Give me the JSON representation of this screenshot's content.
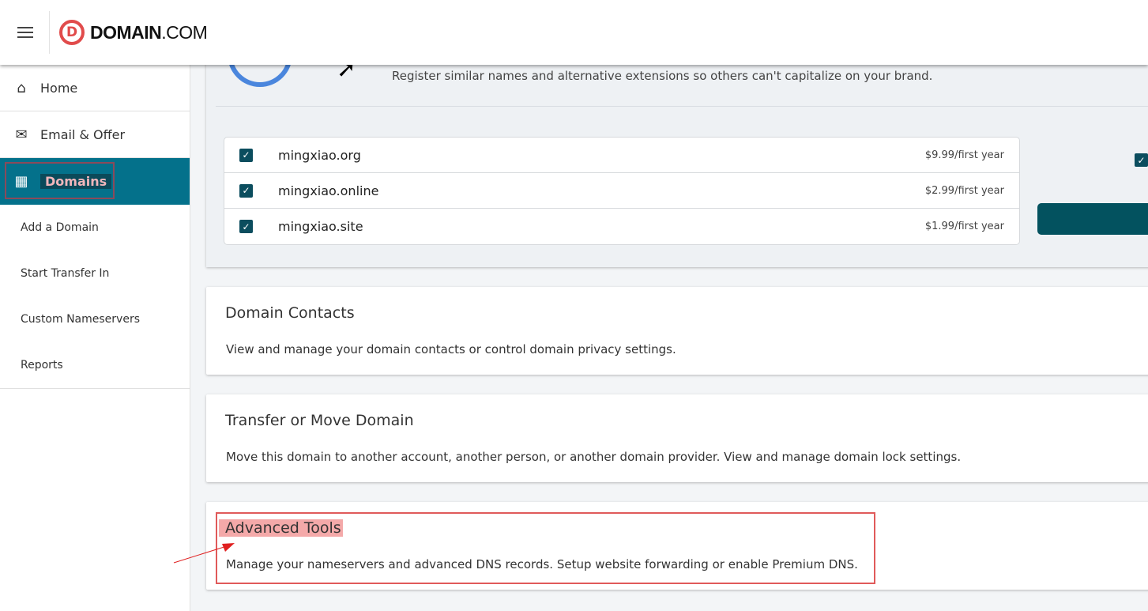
{
  "header": {
    "brand_bold": "DOMAIN",
    "brand_light": ".COM",
    "logo_letter": "D"
  },
  "sidebar": {
    "items": [
      {
        "label": "Home",
        "icon": "home-icon"
      },
      {
        "label": "Email & Offer",
        "icon": "mail-icon"
      },
      {
        "label": "Domains",
        "icon": "building-icon",
        "active": true
      }
    ],
    "subitems": [
      "Add a Domain",
      "Start Transfer In",
      "Custom Nameservers",
      "Reports"
    ]
  },
  "upsell": {
    "description": "Register similar names and alternative extensions so others can't capitalize on your brand.",
    "domains": [
      {
        "name": "mingxiao.org",
        "price": "$9.99/first year",
        "checked": true
      },
      {
        "name": "mingxiao.online",
        "price": "$2.99/first year",
        "checked": true
      },
      {
        "name": "mingxiao.site",
        "price": "$1.99/first year",
        "checked": true
      }
    ]
  },
  "cards": [
    {
      "title": "Domain Contacts",
      "description": "View and manage your domain contacts or control domain privacy settings."
    },
    {
      "title": "Transfer or Move Domain",
      "description": "Move this domain to another account, another person, or another domain provider. View and manage domain lock settings."
    },
    {
      "title": "Advanced Tools",
      "description": "Manage your nameservers and advanced DNS records. Setup website forwarding or enable Premium DNS."
    }
  ],
  "colors": {
    "accent": "#04718b",
    "checkbox": "#0b4d5e",
    "button": "#03525f",
    "logo": "#e14b4b",
    "highlight": "#e05a5a"
  }
}
